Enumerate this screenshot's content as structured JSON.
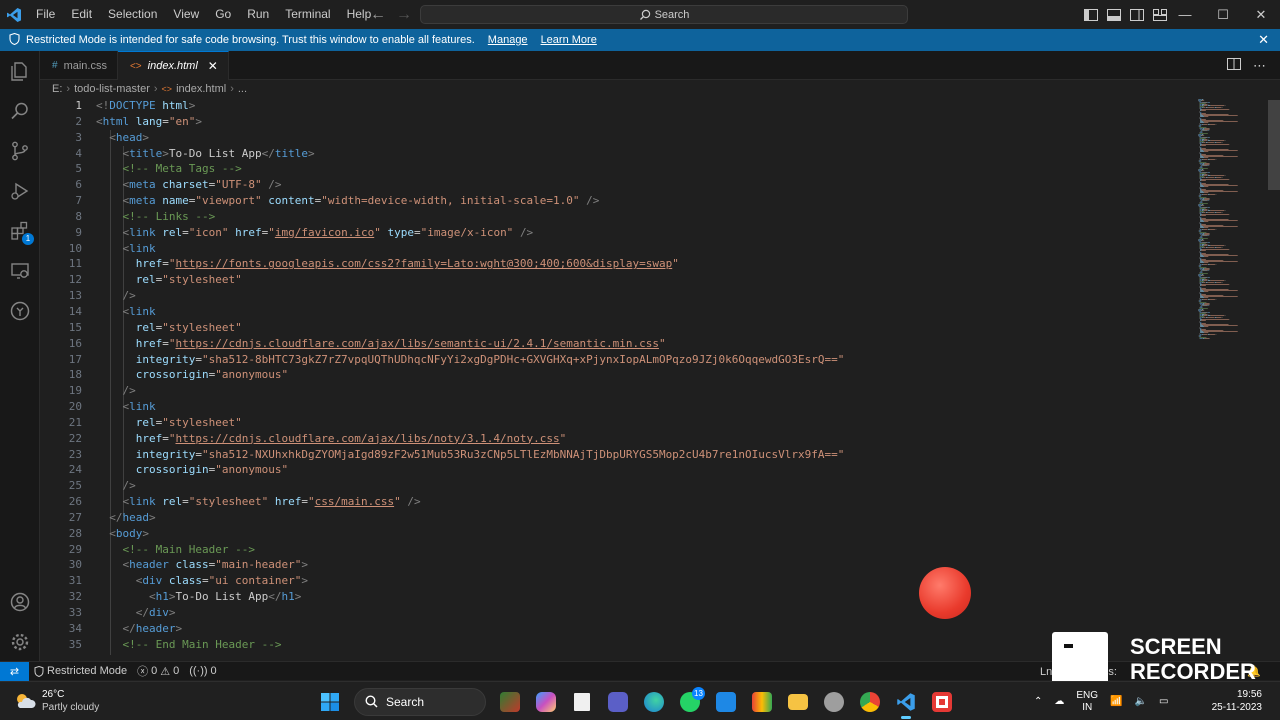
{
  "menu": [
    "File",
    "Edit",
    "Selection",
    "View",
    "Go",
    "Run",
    "Terminal",
    "Help"
  ],
  "command_center": {
    "label": "Search"
  },
  "window_controls": {
    "minimize": "—",
    "maximize": "☐",
    "close": "✕"
  },
  "banner": {
    "text": "Restricted Mode is intended for safe code browsing. Trust this window to enable all features.",
    "manage": "Manage",
    "learn_more": "Learn More"
  },
  "tabs": [
    {
      "label": "main.css",
      "icon": "#"
    },
    {
      "label": "index.html",
      "icon": "<>"
    }
  ],
  "breadcrumb": {
    "drive": "E:",
    "folder": "todo-list-master",
    "file": "index.html",
    "more": "..."
  },
  "editor": {
    "current_line": 1,
    "line_numbers": [
      "1",
      "2",
      "3",
      "4",
      "5",
      "6",
      "7",
      "8",
      "9",
      "10",
      "11",
      "12",
      "13",
      "14",
      "15",
      "16",
      "17",
      "18",
      "19",
      "20",
      "21",
      "22",
      "23",
      "24",
      "25",
      "26",
      "27",
      "28",
      "29",
      "30",
      "31",
      "32",
      "33",
      "34",
      "35"
    ],
    "lines": [
      [
        [
          "t-br",
          "<!"
        ],
        [
          "t-tag",
          "DOCTYPE"
        ],
        [
          "t-txt",
          " "
        ],
        [
          "t-attr",
          "html"
        ],
        [
          "t-br",
          ">"
        ]
      ],
      [
        [
          "t-br",
          "<"
        ],
        [
          "t-tag",
          "html"
        ],
        [
          "t-txt",
          " "
        ],
        [
          "t-attr",
          "lang"
        ],
        [
          "t-txt",
          "="
        ],
        [
          "t-str",
          "\"en\""
        ],
        [
          "t-br",
          ">"
        ]
      ],
      [
        [
          "t-txt",
          "  "
        ],
        [
          "t-br",
          "<"
        ],
        [
          "t-tag",
          "head"
        ],
        [
          "t-br",
          ">"
        ]
      ],
      [
        [
          "t-txt",
          "    "
        ],
        [
          "t-br",
          "<"
        ],
        [
          "t-tag",
          "title"
        ],
        [
          "t-br",
          ">"
        ],
        [
          "t-txt",
          "To-Do List App"
        ],
        [
          "t-br",
          "</"
        ],
        [
          "t-tag",
          "title"
        ],
        [
          "t-br",
          ">"
        ]
      ],
      [
        [
          "t-txt",
          "    "
        ],
        [
          "t-com",
          "<!-- Meta Tags -->"
        ]
      ],
      [
        [
          "t-txt",
          "    "
        ],
        [
          "t-br",
          "<"
        ],
        [
          "t-tag",
          "meta"
        ],
        [
          "t-txt",
          " "
        ],
        [
          "t-attr",
          "charset"
        ],
        [
          "t-txt",
          "="
        ],
        [
          "t-str",
          "\"UTF-8\""
        ],
        [
          "t-txt",
          " "
        ],
        [
          "t-br",
          "/>"
        ]
      ],
      [
        [
          "t-txt",
          "    "
        ],
        [
          "t-br",
          "<"
        ],
        [
          "t-tag",
          "meta"
        ],
        [
          "t-txt",
          " "
        ],
        [
          "t-attr",
          "name"
        ],
        [
          "t-txt",
          "="
        ],
        [
          "t-str",
          "\"viewport\""
        ],
        [
          "t-txt",
          " "
        ],
        [
          "t-attr",
          "content"
        ],
        [
          "t-txt",
          "="
        ],
        [
          "t-str",
          "\"width=device-width, initial-scale=1.0\""
        ],
        [
          "t-txt",
          " "
        ],
        [
          "t-br",
          "/>"
        ]
      ],
      [
        [
          "t-txt",
          "    "
        ],
        [
          "t-com",
          "<!-- Links -->"
        ]
      ],
      [
        [
          "t-txt",
          "    "
        ],
        [
          "t-br",
          "<"
        ],
        [
          "t-tag",
          "link"
        ],
        [
          "t-txt",
          " "
        ],
        [
          "t-attr",
          "rel"
        ],
        [
          "t-txt",
          "="
        ],
        [
          "t-str",
          "\"icon\""
        ],
        [
          "t-txt",
          " "
        ],
        [
          "t-attr",
          "href"
        ],
        [
          "t-txt",
          "="
        ],
        [
          "t-str",
          "\""
        ],
        [
          "t-str t-ul",
          "img/favicon.ico"
        ],
        [
          "t-str",
          "\""
        ],
        [
          "t-txt",
          " "
        ],
        [
          "t-attr",
          "type"
        ],
        [
          "t-txt",
          "="
        ],
        [
          "t-str",
          "\"image/x-icon\""
        ],
        [
          "t-txt",
          " "
        ],
        [
          "t-br",
          "/>"
        ]
      ],
      [
        [
          "t-txt",
          "    "
        ],
        [
          "t-br",
          "<"
        ],
        [
          "t-tag",
          "link"
        ]
      ],
      [
        [
          "t-txt",
          "      "
        ],
        [
          "t-attr",
          "href"
        ],
        [
          "t-txt",
          "="
        ],
        [
          "t-str",
          "\""
        ],
        [
          "t-str t-ul",
          "https://fonts.googleapis.com/css2?family=Lato:wght@300;400;600&display=swap"
        ],
        [
          "t-str",
          "\""
        ]
      ],
      [
        [
          "t-txt",
          "      "
        ],
        [
          "t-attr",
          "rel"
        ],
        [
          "t-txt",
          "="
        ],
        [
          "t-str",
          "\"stylesheet\""
        ]
      ],
      [
        [
          "t-txt",
          "    "
        ],
        [
          "t-br",
          "/>"
        ]
      ],
      [
        [
          "t-txt",
          "    "
        ],
        [
          "t-br",
          "<"
        ],
        [
          "t-tag",
          "link"
        ]
      ],
      [
        [
          "t-txt",
          "      "
        ],
        [
          "t-attr",
          "rel"
        ],
        [
          "t-txt",
          "="
        ],
        [
          "t-str",
          "\"stylesheet\""
        ]
      ],
      [
        [
          "t-txt",
          "      "
        ],
        [
          "t-attr",
          "href"
        ],
        [
          "t-txt",
          "="
        ],
        [
          "t-str",
          "\""
        ],
        [
          "t-str t-ul",
          "https://cdnjs.cloudflare.com/ajax/libs/semantic-ui/2.4.1/semantic.min.css"
        ],
        [
          "t-str",
          "\""
        ]
      ],
      [
        [
          "t-txt",
          "      "
        ],
        [
          "t-attr",
          "integrity"
        ],
        [
          "t-txt",
          "="
        ],
        [
          "t-str",
          "\"sha512-8bHTC73gkZ7rZ7vpqUQThUDhqcNFyYi2xgDgPDHc+GXVGHXq+xPjynxIopALmOPqzo9JZj0k6OqqewdGO3EsrQ==\""
        ]
      ],
      [
        [
          "t-txt",
          "      "
        ],
        [
          "t-attr",
          "crossorigin"
        ],
        [
          "t-txt",
          "="
        ],
        [
          "t-str",
          "\"anonymous\""
        ]
      ],
      [
        [
          "t-txt",
          "    "
        ],
        [
          "t-br",
          "/>"
        ]
      ],
      [
        [
          "t-txt",
          "    "
        ],
        [
          "t-br",
          "<"
        ],
        [
          "t-tag",
          "link"
        ]
      ],
      [
        [
          "t-txt",
          "      "
        ],
        [
          "t-attr",
          "rel"
        ],
        [
          "t-txt",
          "="
        ],
        [
          "t-str",
          "\"stylesheet\""
        ]
      ],
      [
        [
          "t-txt",
          "      "
        ],
        [
          "t-attr",
          "href"
        ],
        [
          "t-txt",
          "="
        ],
        [
          "t-str",
          "\""
        ],
        [
          "t-str t-ul",
          "https://cdnjs.cloudflare.com/ajax/libs/noty/3.1.4/noty.css"
        ],
        [
          "t-str",
          "\""
        ]
      ],
      [
        [
          "t-txt",
          "      "
        ],
        [
          "t-attr",
          "integrity"
        ],
        [
          "t-txt",
          "="
        ],
        [
          "t-str",
          "\"sha512-NXUhxhkDgZYOMjaIgd89zF2w51Mub53Ru3zCNp5LTlEzMbNNAjTjDbpURYGS5Mop2cU4b7re1nOIucsVlrx9fA==\""
        ]
      ],
      [
        [
          "t-txt",
          "      "
        ],
        [
          "t-attr",
          "crossorigin"
        ],
        [
          "t-txt",
          "="
        ],
        [
          "t-str",
          "\"anonymous\""
        ]
      ],
      [
        [
          "t-txt",
          "    "
        ],
        [
          "t-br",
          "/>"
        ]
      ],
      [
        [
          "t-txt",
          "    "
        ],
        [
          "t-br",
          "<"
        ],
        [
          "t-tag",
          "link"
        ],
        [
          "t-txt",
          " "
        ],
        [
          "t-attr",
          "rel"
        ],
        [
          "t-txt",
          "="
        ],
        [
          "t-str",
          "\"stylesheet\""
        ],
        [
          "t-txt",
          " "
        ],
        [
          "t-attr",
          "href"
        ],
        [
          "t-txt",
          "="
        ],
        [
          "t-str",
          "\""
        ],
        [
          "t-str t-ul",
          "css/main.css"
        ],
        [
          "t-str",
          "\""
        ],
        [
          "t-txt",
          " "
        ],
        [
          "t-br",
          "/>"
        ]
      ],
      [
        [
          "t-txt",
          "  "
        ],
        [
          "t-br",
          "</"
        ],
        [
          "t-tag",
          "head"
        ],
        [
          "t-br",
          ">"
        ]
      ],
      [
        [
          "t-txt",
          "  "
        ],
        [
          "t-br",
          "<"
        ],
        [
          "t-tag",
          "body"
        ],
        [
          "t-br",
          ">"
        ]
      ],
      [
        [
          "t-txt",
          "    "
        ],
        [
          "t-com",
          "<!-- Main Header -->"
        ]
      ],
      [
        [
          "t-txt",
          "    "
        ],
        [
          "t-br",
          "<"
        ],
        [
          "t-tag",
          "header"
        ],
        [
          "t-txt",
          " "
        ],
        [
          "t-attr",
          "class"
        ],
        [
          "t-txt",
          "="
        ],
        [
          "t-str",
          "\"main-header\""
        ],
        [
          "t-br",
          ">"
        ]
      ],
      [
        [
          "t-txt",
          "      "
        ],
        [
          "t-br",
          "<"
        ],
        [
          "t-tag",
          "div"
        ],
        [
          "t-txt",
          " "
        ],
        [
          "t-attr",
          "class"
        ],
        [
          "t-txt",
          "="
        ],
        [
          "t-str",
          "\"ui container\""
        ],
        [
          "t-br",
          ">"
        ]
      ],
      [
        [
          "t-txt",
          "        "
        ],
        [
          "t-br",
          "<"
        ],
        [
          "t-tag",
          "h1"
        ],
        [
          "t-br",
          ">"
        ],
        [
          "t-txt",
          "To-Do List App"
        ],
        [
          "t-br",
          "</"
        ],
        [
          "t-tag",
          "h1"
        ],
        [
          "t-br",
          ">"
        ]
      ],
      [
        [
          "t-txt",
          "      "
        ],
        [
          "t-br",
          "</"
        ],
        [
          "t-tag",
          "div"
        ],
        [
          "t-br",
          ">"
        ]
      ],
      [
        [
          "t-txt",
          "    "
        ],
        [
          "t-br",
          "</"
        ],
        [
          "t-tag",
          "header"
        ],
        [
          "t-br",
          ">"
        ]
      ],
      [
        [
          "t-txt",
          "    "
        ],
        [
          "t-com",
          "<!-- End Main Header -->"
        ]
      ]
    ]
  },
  "statusbar": {
    "restricted_mode": "Restricted Mode",
    "errors": "0",
    "warnings": "0",
    "ports": "0",
    "ln_partial": "Ln",
    "spaces_partial": "es:"
  },
  "recorder": {
    "line1": "SCREEN",
    "line2": "RECORDER"
  },
  "taskbar": {
    "temperature": "26°C",
    "condition": "Partly cloudy",
    "search": "Search",
    "whatsapp_badge": "13",
    "lang1": "ENG",
    "lang2": "IN",
    "time": "19:56",
    "date": "25-11-2023"
  },
  "colors": {
    "accent": "#0078d4",
    "banner": "#0e639c",
    "record": "#e93a2c"
  }
}
